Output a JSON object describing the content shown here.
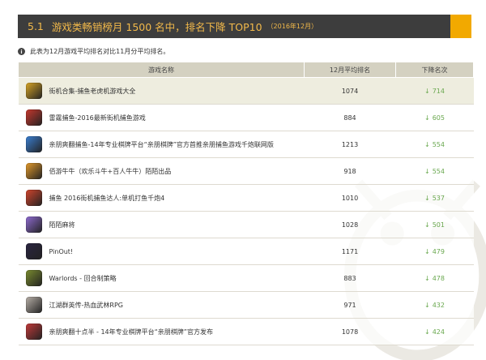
{
  "header": {
    "section_number": "5.1",
    "title": "游戏类畅销榜月 1500 名中，排名下降 TOP10",
    "date": "（2016年12月）"
  },
  "note": {
    "icon": "info-icon",
    "text": "此表为12月游戏平均排名对比11月分平均排名。"
  },
  "table": {
    "headers": {
      "name": "游戏名称",
      "rank": "12月平均排名",
      "drop": "下降名次"
    },
    "rows": [
      {
        "name": "街机合集-捕鱼老虎机游戏大全",
        "rank": "1074",
        "drop": "714",
        "icon_color": "#d8a526"
      },
      {
        "name": "雷霆捕鱼-2016最新街机捕鱼游戏",
        "rank": "884",
        "drop": "605",
        "icon_color": "#c8382e"
      },
      {
        "name": "亲朋爽翻捕鱼-14年专业棋牌平台“亲朋棋牌”官方首推亲朋捕鱼游戏千炮联网版",
        "rank": "1213",
        "drop": "554",
        "icon_color": "#3b7fd1"
      },
      {
        "name": "佰游牛牛（欢乐斗牛+百人牛牛）陌陌出品",
        "rank": "918",
        "drop": "554",
        "icon_color": "#e39a2b"
      },
      {
        "name": "捕鱼 2016街机捕鱼达人:单机打鱼千炮4",
        "rank": "1010",
        "drop": "537",
        "icon_color": "#d2452d"
      },
      {
        "name": "陌陌麻将",
        "rank": "1028",
        "drop": "501",
        "icon_color": "#8f6bd1"
      },
      {
        "name": "PinOut!",
        "rank": "1171",
        "drop": "479",
        "icon_color": "#2a2440"
      },
      {
        "name": "Warlords - 回合制策略",
        "rank": "883",
        "drop": "478",
        "icon_color": "#7a8b2f"
      },
      {
        "name": "江湖群英传-热血武林RPG",
        "rank": "971",
        "drop": "432",
        "icon_color": "#b8b0a8"
      },
      {
        "name": "亲朋爽翻十点半 - 14年专业棋牌平台“亲朋棋牌”官方发布",
        "rank": "1078",
        "drop": "424",
        "icon_color": "#c23a3a"
      }
    ]
  }
}
